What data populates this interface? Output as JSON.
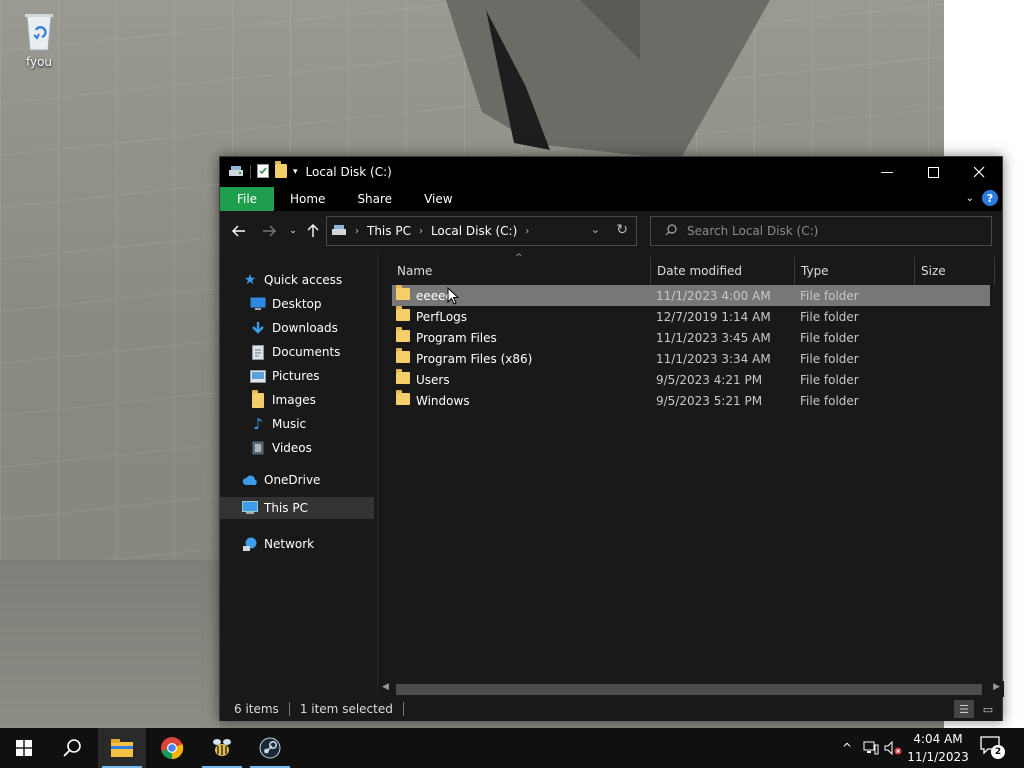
{
  "desktop": {
    "recycle_bin_label": "fyou"
  },
  "window": {
    "title": "Local Disk (C:)",
    "ribbon_tabs": [
      "File",
      "Home",
      "Share",
      "View"
    ],
    "address": {
      "crumbs": [
        "This PC",
        "Local Disk (C:)"
      ]
    },
    "search_placeholder": "Search Local Disk (C:)",
    "nav": {
      "quick_access": "Quick access",
      "items": [
        {
          "label": "Desktop",
          "icon": "desktop-icon",
          "pinned": true
        },
        {
          "label": "Downloads",
          "icon": "download-icon",
          "pinned": true
        },
        {
          "label": "Documents",
          "icon": "document-icon",
          "pinned": true
        },
        {
          "label": "Pictures",
          "icon": "pictures-icon",
          "pinned": true
        },
        {
          "label": "Images",
          "icon": "folder-icon",
          "pinned": false
        },
        {
          "label": "Music",
          "icon": "music-icon",
          "pinned": false
        },
        {
          "label": "Videos",
          "icon": "videos-icon",
          "pinned": false
        }
      ],
      "onedrive": "OneDrive",
      "this_pc": "This PC",
      "network": "Network"
    },
    "columns": [
      "Name",
      "Date modified",
      "Type",
      "Size"
    ],
    "files": [
      {
        "name": "eeeee",
        "date": "11/1/2023 4:00 AM",
        "type": "File folder",
        "selected": true
      },
      {
        "name": "PerfLogs",
        "date": "12/7/2019 1:14 AM",
        "type": "File folder",
        "selected": false
      },
      {
        "name": "Program Files",
        "date": "11/1/2023 3:45 AM",
        "type": "File folder",
        "selected": false
      },
      {
        "name": "Program Files (x86)",
        "date": "11/1/2023 3:34 AM",
        "type": "File folder",
        "selected": false
      },
      {
        "name": "Users",
        "date": "9/5/2023 4:21 PM",
        "type": "File folder",
        "selected": false
      },
      {
        "name": "Windows",
        "date": "9/5/2023 5:21 PM",
        "type": "File folder",
        "selected": false
      }
    ],
    "status": {
      "item_count": "6 items",
      "selection": "1 item selected"
    }
  },
  "taskbar": {
    "time": "4:04 AM",
    "date": "11/1/2023",
    "notification_count": "2",
    "colors": {
      "active_underline": "#76b9ed",
      "file_tab": "#1f9e4d",
      "selected_row": "#777777"
    }
  }
}
